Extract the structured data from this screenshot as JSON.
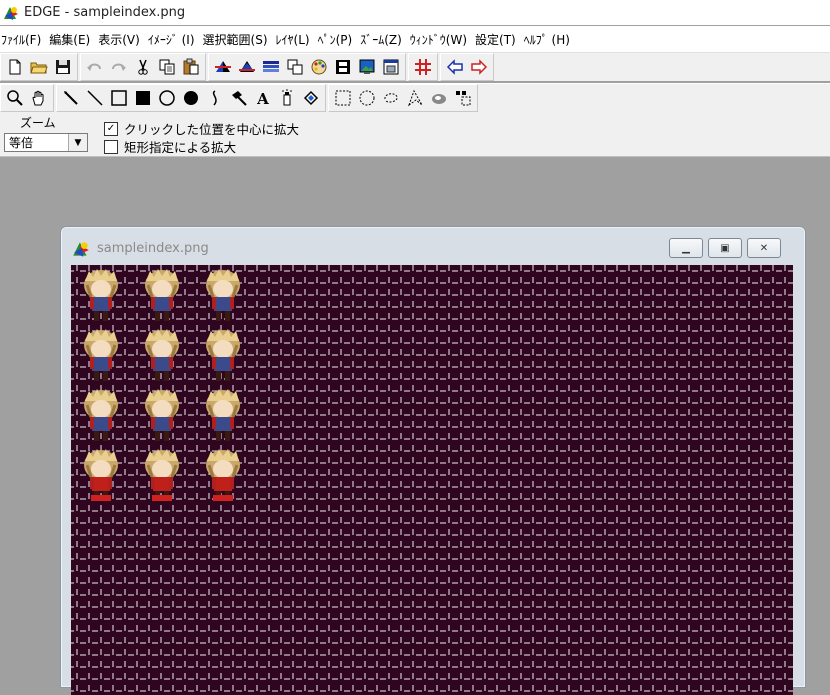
{
  "app": {
    "title": "EDGE - sampleindex.png",
    "icon": "edge-rainbow-icon"
  },
  "menu": [
    "ﾌｧｲﾙ(F)",
    "編集(E)",
    "表示(V)",
    "ｲﾒｰｼﾞ (I)",
    "選択範囲(S)",
    "ﾚｲﾔ(L)",
    "ﾍﾟﾝ(P)",
    "ｽﾞｰﾑ(Z)",
    "ｳｨﾝﾄﾞｳ(W)",
    "設定(T)",
    "ﾍﾙﾌﾟ (H)"
  ],
  "toolbar1": [
    [
      "new-file-icon",
      "open-folder-icon",
      "save-disk-icon"
    ],
    [
      "undo-icon",
      "redo-icon",
      "cut-scissors-icon",
      "copy-icon",
      "paste-icon"
    ],
    [
      "mirror-horizontal-icon",
      "mirror-vertical-icon",
      "palette-bar-icon",
      "layers-icon",
      "palette-icon",
      "film-icon",
      "image-view-icon",
      "window-icon"
    ],
    [
      "grid-icon"
    ],
    [
      "arrow-left-icon",
      "arrow-right-icon"
    ]
  ],
  "toolbar2": [
    [
      "zoom-tool-icon",
      "hand-tool-icon"
    ],
    [
      "pencil-tool-icon",
      "line-tool-icon",
      "rect-outline-icon",
      "rect-filled-icon",
      "ellipse-outline-icon",
      "ellipse-filled-icon",
      "curve-tool-icon",
      "pick-tool-icon",
      "text-tool-icon",
      "spray-tool-icon",
      "fill-tool-icon"
    ],
    [
      "rect-select-icon",
      "ellipse-select-icon",
      "lasso-select-icon",
      "polygon-select-icon",
      "magic-select-icon",
      "dot-select-icon"
    ]
  ],
  "zoom": {
    "label": "ズーム",
    "selected": "等倍",
    "option_center": "クリックした位置を中心に拡大",
    "option_center_checked": true,
    "option_rect": "矩形指定による拡大",
    "option_rect_checked": false
  },
  "document": {
    "title": "sampleindex.png",
    "icon": "edge-rainbow-icon",
    "canvas_bg": "#2f0520",
    "sprites": {
      "rows": 4,
      "cols": 3,
      "hair": "#c9a86a",
      "outfit_top_rows": "#3a4a8a",
      "outfit_bottom_row": "#c0201a"
    }
  },
  "colors": {
    "workspace": "#a0a0a0",
    "toolbar": "#f0f0f0"
  }
}
